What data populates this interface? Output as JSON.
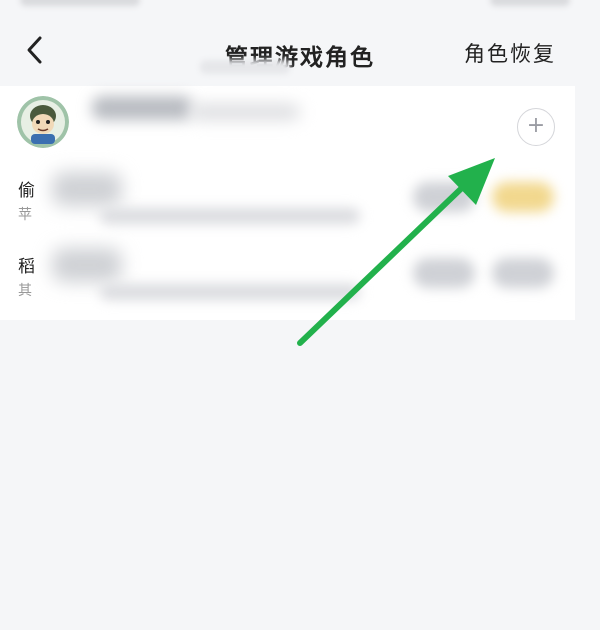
{
  "nav": {
    "title": "管理游戏角色",
    "restore_label": "角色恢复"
  },
  "account": {
    "add_symbol": "+"
  },
  "roles": [
    {
      "name": "偷",
      "server": "苹"
    },
    {
      "name": "稻",
      "server": "其"
    }
  ],
  "colors": {
    "background": "#f5f6f8",
    "card": "#ffffff",
    "annotation_arrow": "#22b14c",
    "highlight_button": "#f2d88e"
  }
}
